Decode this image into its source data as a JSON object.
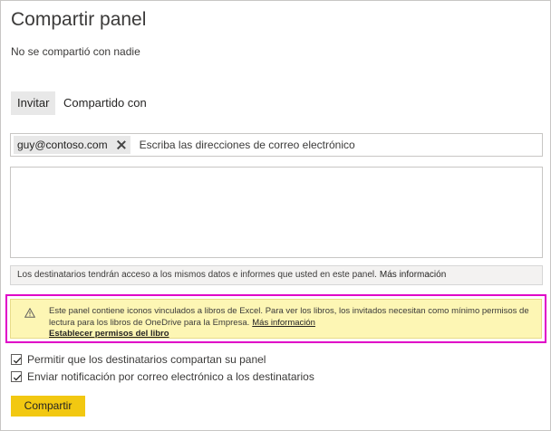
{
  "dialog": {
    "title": "Compartir panel",
    "subtitle": "No se compartió con nadie"
  },
  "tabs": [
    {
      "label": "Invitar",
      "active": true
    },
    {
      "label": "Compartido con",
      "active": false
    }
  ],
  "email": {
    "chips": [
      "guy@contoso.com"
    ],
    "placeholder": "Escriba las direcciones de correo electrónico",
    "value": ""
  },
  "message": {
    "value": ""
  },
  "info": {
    "text": "Los destinatarios tendrán acceso a los mismos datos e informes que usted en este panel.",
    "link": "Más información"
  },
  "warning": {
    "icon": "warning-triangle-icon",
    "text": "Este panel contiene iconos vinculados a libros de Excel. Para ver los libros, los invitados necesitan como mínimo permisos de lectura para los libros de OneDrive para la Empresa.",
    "link": "Más información",
    "action": "Establecer permisos del libro",
    "highlight_color": "#e000c8",
    "background_color": "#fdf6b4"
  },
  "options": [
    {
      "label": "Permitir que los destinatarios compartan su panel",
      "checked": true
    },
    {
      "label": "Enviar notificación por correo electrónico a los destinatarios",
      "checked": true
    }
  ],
  "actions": {
    "share_label": "Compartir",
    "share_color": "#f2c811"
  }
}
